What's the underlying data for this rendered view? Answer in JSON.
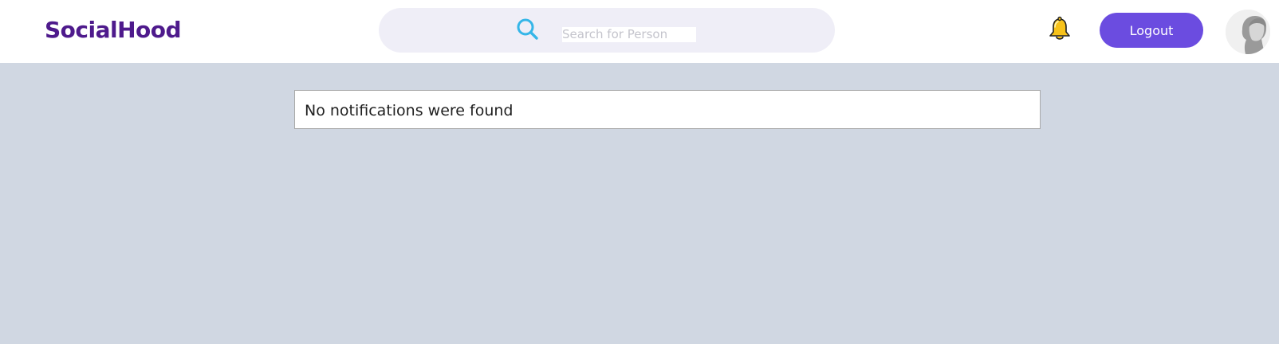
{
  "header": {
    "brand": "SocialHood",
    "search": {
      "placeholder": "Search for Person",
      "value": "",
      "icon": "search-icon"
    },
    "notifications_icon": "bell-icon",
    "logout_label": "Logout",
    "avatar_icon": "user-avatar"
  },
  "main": {
    "empty_message": "No notifications were found"
  },
  "colors": {
    "brand": "#4e1a8c",
    "accent": "#6b4ce0",
    "page_background": "#d0d7e2",
    "search_background": "#efeef7",
    "search_icon": "#35b6e8",
    "bell": "#f7c21a"
  }
}
